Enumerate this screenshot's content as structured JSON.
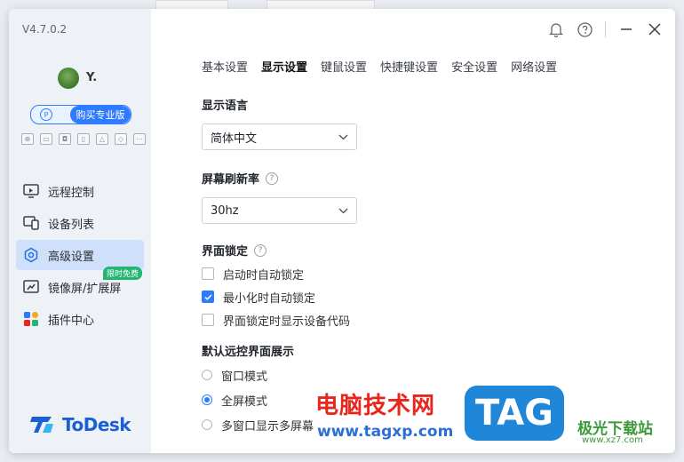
{
  "app": {
    "version": "V4.7.0.2",
    "username": "Y.",
    "buy_pro_label": "购买专业版",
    "logo_text": "ToDesk"
  },
  "sidebar": {
    "mini_icons": [
      "gamepad-icon",
      "screen-icon",
      "camera-icon",
      "device-icon",
      "cloud-icon",
      "plugin-icon",
      "more-icon"
    ],
    "items": [
      {
        "label": "远程控制",
        "icon": "remote-control-icon",
        "active": false
      },
      {
        "label": "设备列表",
        "icon": "device-list-icon",
        "active": false
      },
      {
        "label": "高级设置",
        "icon": "settings-icon",
        "active": true
      },
      {
        "label": "镜像屏/扩展屏",
        "icon": "mirror-screen-icon",
        "active": false,
        "badge": "限时免费"
      },
      {
        "label": "插件中心",
        "icon": "plugin-center-icon",
        "active": false
      }
    ]
  },
  "tabs": [
    {
      "label": "基本设置",
      "active": false
    },
    {
      "label": "显示设置",
      "active": true
    },
    {
      "label": "键鼠设置",
      "active": false
    },
    {
      "label": "快捷键设置",
      "active": false
    },
    {
      "label": "安全设置",
      "active": false
    },
    {
      "label": "网络设置",
      "active": false
    }
  ],
  "display": {
    "language": {
      "title": "显示语言",
      "value": "简体中文"
    },
    "refresh": {
      "title": "屏幕刷新率",
      "value": "30hz"
    },
    "lock": {
      "title": "界面锁定",
      "options": [
        {
          "label": "启动时自动锁定",
          "checked": false
        },
        {
          "label": "最小化时自动锁定",
          "checked": true
        },
        {
          "label": "界面锁定时显示设备代码",
          "checked": false
        }
      ]
    },
    "remote_view": {
      "title": "默认远控界面展示",
      "options": [
        {
          "label": "窗口模式",
          "checked": false
        },
        {
          "label": "全屏模式",
          "checked": true
        },
        {
          "label": "多窗口显示多屏幕",
          "checked": false
        }
      ]
    }
  },
  "watermark": {
    "title": "电脑技术网",
    "url": "www.tagxp.com",
    "tag": "TAG",
    "site": "极光下载站",
    "site_url": "www.xz7.com"
  },
  "colors": {
    "accent": "#2f7bff",
    "sidebar_bg": "#eef1f6",
    "active_nav": "#cfe0fb",
    "badge": "#22b573"
  }
}
